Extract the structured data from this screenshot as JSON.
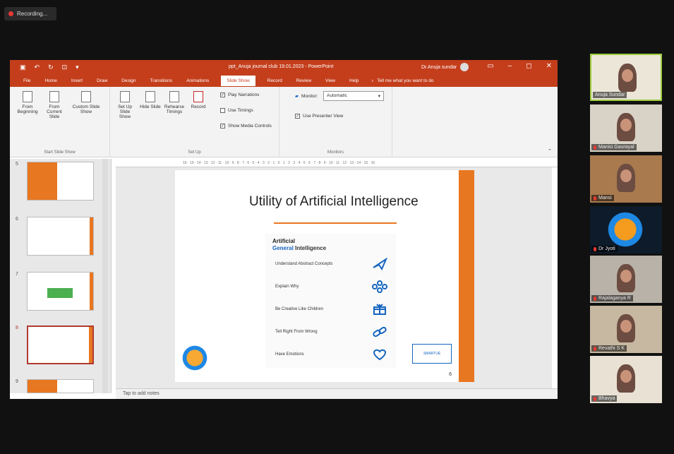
{
  "recording": {
    "label": "Recording..."
  },
  "ppt": {
    "window_title": "ppt_Anuja journal club 19.01.2023 - PowerPoint",
    "user_name": "Dr.Anuja sundar",
    "menu_tabs": [
      "File",
      "Home",
      "Insert",
      "Draw",
      "Design",
      "Transitions",
      "Animations",
      "Slide Show",
      "Record",
      "Review",
      "View",
      "Help"
    ],
    "active_tab": "Slide Show",
    "tell_me": "Tell me what you want to do",
    "ribbon": {
      "start_group": {
        "title": "Start Slide Show",
        "buttons": [
          "From Beginning",
          "From Current Slide",
          "Custom Slide Show"
        ]
      },
      "setup_group": {
        "title": "Set Up",
        "buttons": [
          "Set Up Slide Show",
          "Hide Slide",
          "Rehearse Timings",
          "Record"
        ],
        "checks": [
          {
            "label": "Play Narrations",
            "checked": true
          },
          {
            "label": "Use Timings",
            "checked": false
          },
          {
            "label": "Show Media Controls",
            "checked": true
          }
        ]
      },
      "monitors_group": {
        "title": "Monitors",
        "monitor_label": "Monitor:",
        "monitor_value": "Automatic",
        "presenter_view": "Use Presenter View",
        "presenter_checked": true
      }
    },
    "ruler_text": "16 · 15 · 14 · 13 · 12 · 11 · 10 · 9 · 8 · 7 · 6 · 5 · 4 · 3 · 2 · 1 · 0 · 1 · 2 · 3 · 4 · 5 · 6 · 7 · 8 · 9 · 10 · 11 · 12 · 13 · 14 · 15 · 16",
    "thumbnails": [
      {
        "number": "5"
      },
      {
        "number": "6"
      },
      {
        "number": "7"
      },
      {
        "number": "8",
        "selected": true
      },
      {
        "number": "9"
      }
    ],
    "slide": {
      "title": "Utility of Artificial Intelligence",
      "box_heading_1": "Artificial",
      "box_heading_2a": "General",
      "box_heading_2b": " Intelligence",
      "items": [
        {
          "text": "Understand Abstract Concepts",
          "icon": "plane-icon"
        },
        {
          "text": "Explain Why",
          "icon": "network-icon"
        },
        {
          "text": "Be Creative Like Children",
          "icon": "gift-icon"
        },
        {
          "text": "Tell Right From Wrong",
          "icon": "link-icon"
        },
        {
          "text": "Have Emotions",
          "icon": "heart-icon"
        }
      ],
      "page_number": "6",
      "smart_logo": "SMARTUE"
    },
    "notes_placeholder": "Tap to add notes"
  },
  "participants": [
    {
      "name": "Anuja Sundar",
      "active": true
    },
    {
      "name": "Manisi Gaurayal"
    },
    {
      "name": "Mansi"
    },
    {
      "name": "Dr Jyoti"
    },
    {
      "name": "Rajalaganya R"
    },
    {
      "name": "Revathi S K"
    },
    {
      "name": "Bhavya"
    }
  ],
  "colors": {
    "ppt_red": "#c43e1c",
    "accent_orange": "#e87722",
    "blue": "#1565c0"
  }
}
